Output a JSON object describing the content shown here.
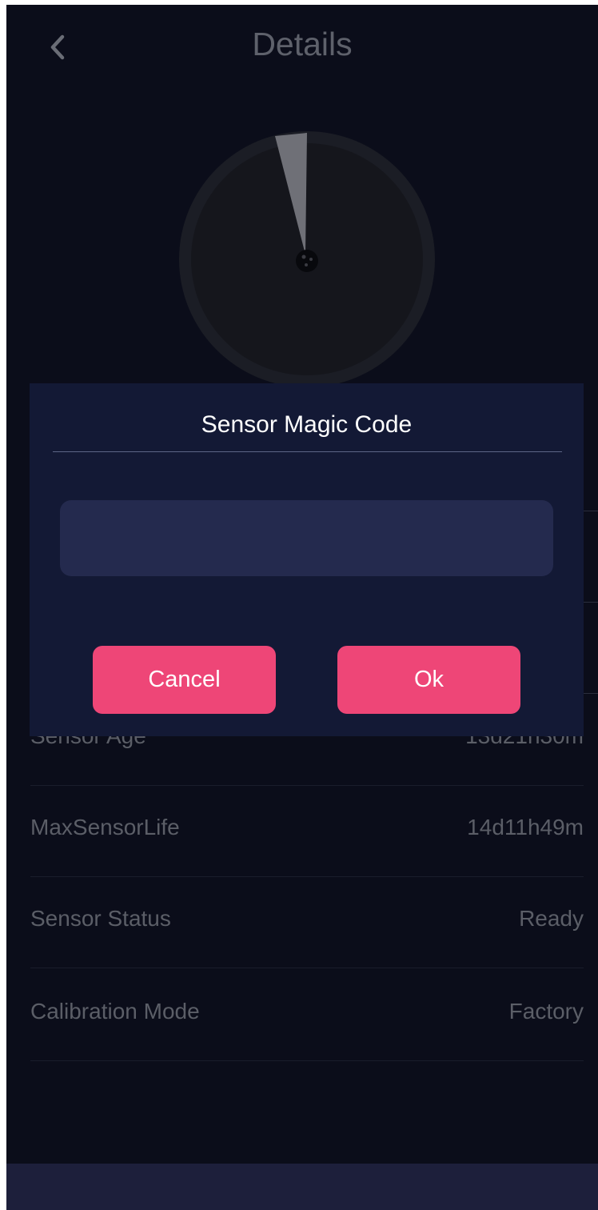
{
  "header": {
    "title": "Details",
    "back_icon": "chevron-left-icon"
  },
  "gauge": {
    "icon": "sensor-dial-icon"
  },
  "details": [
    {
      "label": "Sensor Age",
      "value": "13d21h30m"
    },
    {
      "label": "MaxSensorLife",
      "value": "14d11h49m"
    },
    {
      "label": "Sensor Status",
      "value": "Ready"
    },
    {
      "label": "Calibration Mode",
      "value": "Factory"
    }
  ],
  "dialog": {
    "title": "Sensor Magic Code",
    "input_value": "",
    "input_placeholder": "",
    "cancel_label": "Cancel",
    "ok_label": "Ok"
  },
  "colors": {
    "background": "#0b0d1a",
    "dialog_background": "#131935",
    "input_background": "#242a4e",
    "accent": "#ee4677",
    "bottom_bar": "#1d1f3b"
  }
}
